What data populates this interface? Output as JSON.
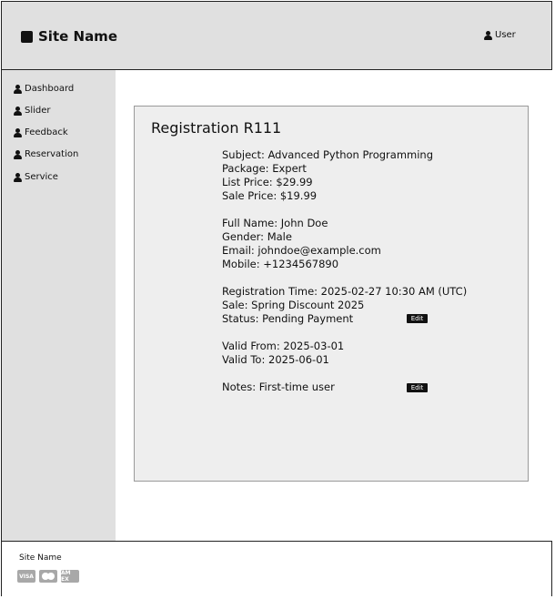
{
  "header": {
    "site_name": "Site Name",
    "user_label": "User"
  },
  "sidebar": {
    "items": [
      {
        "label": "Dashboard"
      },
      {
        "label": "Slider"
      },
      {
        "label": "Feedback"
      },
      {
        "label": "Reservation"
      },
      {
        "label": "Service"
      }
    ]
  },
  "registration": {
    "title": "Registration R111",
    "subject": "Subject: Advanced Python Programming",
    "package": "Package:  Expert",
    "list_price": "List Price: $29.99",
    "sale_price": "Sale Price: $19.99",
    "full_name": "Full Name: John Doe",
    "gender": "Gender: Male",
    "email": "Email: johndoe@example.com",
    "mobile": "Mobile: +1234567890",
    "registration_time": "Registration Time: 2025-02-27 10:30 AM (UTC)",
    "sale": "Sale: Spring Discount 2025",
    "status": "Status: Pending Payment",
    "valid_from": "Valid From: 2025-03-01",
    "valid_to": "Valid To: 2025-06-01",
    "notes": "Notes: First-time user",
    "edit_label": "Edit"
  },
  "footer": {
    "site_name": "Site Name",
    "payment_icons": [
      "visa-icon",
      "mastercard-icon",
      "amex-icon"
    ],
    "visa_label": "VISA",
    "amex_label": "AM EX"
  }
}
